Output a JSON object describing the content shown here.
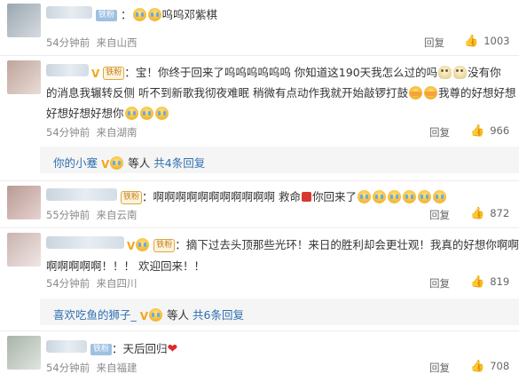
{
  "colors": {
    "link": "#2f6fb0",
    "badge_vip": "#f3a61b",
    "heart": "#e0282a",
    "fan_badge": "#9fc0e2"
  },
  "comments": [
    {
      "fan_badge": "铁粉",
      "text": "呜呜邓紫棋",
      "time": "54分钟前",
      "location": "来自山西",
      "reply_label": "回复",
      "likes": "1003"
    },
    {
      "fan_badge": "铁粉",
      "line1_a": "宝！你终于回来了呜呜呜呜呜呜 你知道这190天我怎么过的吗",
      "line1_b": "没有你",
      "line2_a": "的消息我辗转反侧 听不到新歌我彻夜难眠 稍微有点动作我就开始敲锣打鼓",
      "line2_b": "我尊的好想好想",
      "line3": "好想好想好想你",
      "time": "54分钟前",
      "location": "来自湖南",
      "reply_label": "回复",
      "likes": "966",
      "sub": {
        "name": "你的小蹇",
        "suffix": "等人",
        "count": "共4条回复"
      }
    },
    {
      "fan_badge": "铁粉",
      "text_a": "啊啊啊啊啊啊啊啊啊啊啊 救命",
      "text_b": "你回来了",
      "time": "55分钟前",
      "location": "来自云南",
      "reply_label": "回复",
      "likes": "872"
    },
    {
      "fan_badge": "铁粉",
      "line1": "摘下过去头顶那些光环！来日的胜利却会更壮观！我真的好想你啊啊",
      "line2": "啊啊啊啊啊！！！ 欢迎回来！！",
      "time": "54分钟前",
      "location": "来自四川",
      "reply_label": "回复",
      "likes": "819",
      "sub": {
        "name": "喜欢吃鱼的狮子_",
        "suffix": "等人",
        "count": "共6条回复"
      }
    },
    {
      "fan_badge": "铁粉",
      "text": "天后回归",
      "time": "54分钟前",
      "location": "来自福建",
      "reply_label": "回复",
      "likes": "708"
    }
  ]
}
